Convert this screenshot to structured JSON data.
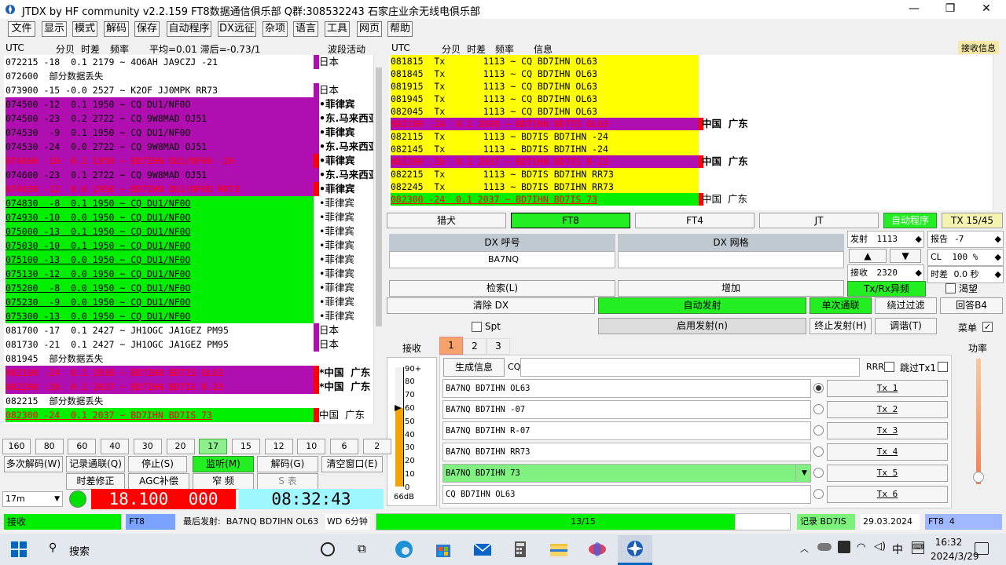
{
  "window": {
    "title": "JTDX by HF community  v2.2.159 FT8数据通信俱乐部 Q群:308532243 石家庄业余无线电俱乐部",
    "controls": [
      "—",
      "❐",
      "✕"
    ]
  },
  "menu": [
    "文件",
    "显示",
    "模式",
    "解码",
    "保存",
    "自动程序",
    "DX远征",
    "杂项",
    "语言",
    "工具",
    "网页",
    "帮助"
  ],
  "left_header": {
    "utc": "UTC",
    "db": "分贝",
    "dt": "时差",
    "freq": "频率",
    "stats": "平均=0.01 滞后=-0.73/1",
    "band": "波段活动"
  },
  "right_header": {
    "utc": "UTC",
    "db": "分贝",
    "dt": "时差",
    "freq": "频率",
    "msg": "信息",
    "rxinfo": "接收信息"
  },
  "band_activity": [
    {
      "text": "072215 -18  0.1 2179 ~ 4O6AH JA9CZJ -21",
      "country": "日本",
      "bg": "#ffffff",
      "fg": "#000000",
      "flag": "#b10eb1",
      "cw": "normal"
    },
    {
      "text": "072600  部分数据丢失",
      "country": "",
      "bg": "#ffffff",
      "fg": "#000000",
      "flag": "",
      "cw": "normal"
    },
    {
      "text": "073900 -15 -0.0 2527 ~ K2OF JJ0MPK RR73",
      "country": "日本",
      "bg": "#ffffff",
      "fg": "#000000",
      "flag": "#b10eb1",
      "cw": "normal"
    },
    {
      "text": "074500 -12  0.1 1950 ~ CQ DU1/NF0O",
      "country": "•菲律宾",
      "bg": "#b10eb1",
      "fg": "#000000",
      "flag": "#b10eb1",
      "cw": "bold"
    },
    {
      "text": "074500 -23  0.2 2722 ~ CQ 9W8MAD OJ51",
      "country": "•东.马来西亚",
      "bg": "#b10eb1",
      "fg": "#000000",
      "flag": "#b10eb1",
      "cw": "bold"
    },
    {
      "text": "074530  -9  0.1 1950 ~ CQ DU1/NF0O",
      "country": "•菲律宾",
      "bg": "#b10eb1",
      "fg": "#000000",
      "flag": "#b10eb1",
      "cw": "bold"
    },
    {
      "text": "074530 -24  0.0 2722 ~ CQ 9W8MAD OJ51",
      "country": "•东.马来西亚",
      "bg": "#b10eb1",
      "fg": "#000000",
      "flag": "#b10eb1",
      "cw": "bold"
    },
    {
      "text": "074600 -10  0.1 1950 ~ BD7IHN DU1/NF0O -20",
      "country": "•菲律宾",
      "bg": "#b10eb1",
      "fg": "#ff0000",
      "flag": "#ff0000",
      "cw": "bold"
    },
    {
      "text": "074600 -23  0.1 2722 ~ CQ 9W8MAD OJ51",
      "country": "•东.马来西亚",
      "bg": "#b10eb1",
      "fg": "#000000",
      "flag": "#b10eb1",
      "cw": "bold"
    },
    {
      "text": "074630 -12  0.0 1950 ~ BD7IHN DU1/NF0O RR73",
      "country": "•菲律宾",
      "bg": "#b10eb1",
      "fg": "#ff0000",
      "flag": "#ff0000",
      "cw": "bold"
    },
    {
      "text": "074830  -8  0.1 1950 ~ CQ DU1/NF0O",
      "country": "•菲律宾",
      "bg": "#00ee00",
      "fg": "#000000",
      "flag": "",
      "cw": "normal",
      "u": true
    },
    {
      "text": "074930 -10  0.0 1950 ~ CQ DU1/NF0O",
      "country": "•菲律宾",
      "bg": "#00ee00",
      "fg": "#000000",
      "flag": "",
      "cw": "normal",
      "u": true
    },
    {
      "text": "075000 -13  0.1 1950 ~ CQ DU1/NF0O",
      "country": "•菲律宾",
      "bg": "#00ee00",
      "fg": "#000000",
      "flag": "",
      "cw": "normal",
      "u": true
    },
    {
      "text": "075030 -10  0.1 1950 ~ CQ DU1/NF0O",
      "country": "•菲律宾",
      "bg": "#00ee00",
      "fg": "#000000",
      "flag": "",
      "cw": "normal",
      "u": true
    },
    {
      "text": "075100 -13  0.0 1950 ~ CQ DU1/NF0O",
      "country": "•菲律宾",
      "bg": "#00ee00",
      "fg": "#000000",
      "flag": "",
      "cw": "normal",
      "u": true
    },
    {
      "text": "075130 -12  0.0 1950 ~ CQ DU1/NF0O",
      "country": "•菲律宾",
      "bg": "#00ee00",
      "fg": "#000000",
      "flag": "",
      "cw": "normal",
      "u": true
    },
    {
      "text": "075200  -8  0.0 1950 ~ CQ DU1/NF0O",
      "country": "•菲律宾",
      "bg": "#00ee00",
      "fg": "#000000",
      "flag": "",
      "cw": "normal",
      "u": true
    },
    {
      "text": "075230  -9  0.0 1950 ~ CQ DU1/NF0O",
      "country": "•菲律宾",
      "bg": "#00ee00",
      "fg": "#000000",
      "flag": "",
      "cw": "normal",
      "u": true
    },
    {
      "text": "075300 -13  0.0 1950 ~ CQ DU1/NF0O",
      "country": "•菲律宾",
      "bg": "#00ee00",
      "fg": "#000000",
      "flag": "",
      "cw": "normal",
      "u": true
    },
    {
      "text": "081700 -17  0.1 2427 ~ JH1OGC JA1GEZ PM95",
      "country": "日本",
      "bg": "#ffffff",
      "fg": "#000000",
      "flag": "#b10eb1",
      "cw": "normal"
    },
    {
      "text": "081730 -21  0.1 2427 ~ JH1OGC JA1GEZ PM95",
      "country": "日本",
      "bg": "#ffffff",
      "fg": "#000000",
      "flag": "#b10eb1",
      "cw": "normal"
    },
    {
      "text": "081945  部分数据丢失",
      "country": "",
      "bg": "#ffffff",
      "fg": "#000000",
      "flag": "",
      "cw": "normal"
    },
    {
      "text": "082100 -24  0.1 2038 ~ BD7IHN BD7IS OL63",
      "country": "*中国  广东",
      "bg": "#b10eb1",
      "fg": "#ff0000",
      "flag": "#ff0000",
      "cw": "bold"
    },
    {
      "text": "082200 -26  0.1 2037 ~ BD7IHN BD7IS R-23",
      "country": "*中国  广东",
      "bg": "#b10eb1",
      "fg": "#ff0000",
      "flag": "#ff0000",
      "cw": "bold"
    },
    {
      "text": "082215  部分数据丢失",
      "country": "",
      "bg": "#ffffff",
      "fg": "#000000",
      "flag": "",
      "cw": "normal"
    },
    {
      "text": "082300 -24  0.1 2037 ~ BD7IHN BD7IS 73",
      "country": "中国  广东",
      "bg": "#00ee00",
      "fg": "#ff0000",
      "flag": "#ff0000",
      "cw": "normal",
      "u": true
    },
    {
      "text": "082345  部分数据丢失",
      "country": "",
      "bg": "#ffffff",
      "fg": "#000000",
      "flag": "",
      "cw": "normal"
    }
  ],
  "rx_messages": [
    {
      "text": "081815  Tx       1113 ~ CQ BD7IHN OL63",
      "country": "",
      "bg": "#ffff00",
      "fg": "#000000",
      "flag": "",
      "u": false
    },
    {
      "text": "081845  Tx       1113 ~ CQ BD7IHN OL63",
      "country": "",
      "bg": "#ffff00",
      "fg": "#000000",
      "flag": "",
      "u": false
    },
    {
      "text": "081915  Tx       1113 ~ CQ BD7IHN OL63",
      "country": "",
      "bg": "#ffff00",
      "fg": "#000000",
      "flag": "",
      "u": false
    },
    {
      "text": "081945  Tx       1113 ~ CQ BD7IHN OL63",
      "country": "",
      "bg": "#ffff00",
      "fg": "#000000",
      "flag": "",
      "u": false
    },
    {
      "text": "082045  Tx       1113 ~ CQ BD7IHN OL63",
      "country": "",
      "bg": "#ffff00",
      "fg": "#000000",
      "flag": "",
      "u": false
    },
    {
      "text": "082100 -24  0.1 2038 ~ BD7IHN BD7IS OL63",
      "country": "中国  广东",
      "bg": "#b10eb1",
      "fg": "#ff0000",
      "flag": "#ff0000",
      "u": false
    },
    {
      "text": "082115  Tx       1113 ~ BD7IS BD7IHN -24",
      "country": "",
      "bg": "#ffff00",
      "fg": "#000000",
      "flag": "",
      "u": false
    },
    {
      "text": "082145  Tx       1113 ~ BD7IS BD7IHN -24",
      "country": "",
      "bg": "#ffff00",
      "fg": "#000000",
      "flag": "",
      "u": false
    },
    {
      "text": "082200 -26  0.1 2037 ~ BD7IHN BD7IS R-23",
      "country": "中国  广东",
      "bg": "#b10eb1",
      "fg": "#ff0000",
      "flag": "#ff0000",
      "u": false
    },
    {
      "text": "082215  Tx       1113 ~ BD7IS BD7IHN RR73",
      "country": "",
      "bg": "#ffff00",
      "fg": "#000000",
      "flag": "",
      "u": false
    },
    {
      "text": "082245  Tx       1113 ~ BD7IS BD7IHN RR73",
      "country": "",
      "bg": "#ffff00",
      "fg": "#000000",
      "flag": "",
      "u": false
    },
    {
      "text": "082300 -24  0.1 2037 ~ BD7IHN BD7IS 73",
      "country": "中国  广东",
      "bg": "#00ee00",
      "fg": "#ff0000",
      "flag": "#ff0000",
      "u": true
    }
  ],
  "bands": [
    "160",
    "80",
    "60",
    "40",
    "30",
    "20",
    "17",
    "15",
    "12",
    "10",
    "6",
    "2"
  ],
  "active_band": "17",
  "left_buttons_row1": [
    "多次解码(W)",
    "记录通联(Q)",
    "停止(S)",
    "监听(M)",
    "解码(G)",
    "清空窗口(E)"
  ],
  "left_buttons_row2": [
    "时差修正",
    "AGC补偿",
    "窄 频",
    "S 表"
  ],
  "band_select": "17m",
  "frequency": "18.100  000",
  "clock": "08:32:43",
  "mode_buttons": [
    "猎犬",
    "FT8",
    "FT4",
    "JT",
    "自动程序",
    "TX 15/45"
  ],
  "dx": {
    "call_label": "DX 呼号",
    "grid_label": "DX 网格",
    "call": "BA7NQ",
    "grid": ""
  },
  "tx_freq": {
    "label": "发射",
    "value": "1113"
  },
  "rx_freq": {
    "label": "接收",
    "value": "2320"
  },
  "report": {
    "label": "报告",
    "value": "-7"
  },
  "cl": {
    "label": "CL",
    "value": "100 %"
  },
  "time_offset": {
    "label": "时差",
    "value": "0.0 秒"
  },
  "txrx_split": "Tx/Rx异频",
  "hope": "渴望",
  "buttons": {
    "search": "检索(L)",
    "add": "增加",
    "clear_dx": "清除 DX",
    "auto_tx": "自动发射",
    "single_qso": "单次通联",
    "skip_filter": "绕过过滤",
    "reply_b4": "回答B4",
    "spt": "Spt",
    "enable_tx": "启用发射(n)",
    "stop_tx": "终止发射(H)",
    "tune": "调谐(T)",
    "menu": "菜单"
  },
  "rx_label": "接收",
  "power_label": "功率",
  "tabs": [
    "1",
    "2",
    "3"
  ],
  "generate": {
    "label": "生成信息",
    "prefix": "CQ",
    "value": "",
    "rrr": "RRR",
    "skip_tx1": "跳过Tx1"
  },
  "tx_messages": [
    {
      "text": "BA7NQ BD7IHN OL63",
      "btn": "Tx 1",
      "selected": true,
      "highlight": false
    },
    {
      "text": "BA7NQ BD7IHN -07",
      "btn": "Tx 2",
      "selected": false,
      "highlight": false
    },
    {
      "text": "BA7NQ BD7IHN R-07",
      "btn": "Tx 3",
      "selected": false,
      "highlight": false
    },
    {
      "text": "BA7NQ BD7IHN RR73",
      "btn": "Tx 4",
      "selected": false,
      "highlight": false
    },
    {
      "text": "BA7NQ BD7IHN 73",
      "btn": "Tx 5",
      "selected": false,
      "highlight": true
    },
    {
      "text": "CQ BD7IHN OL63",
      "btn": "Tx 6",
      "selected": false,
      "highlight": false
    }
  ],
  "meter": {
    "ticks": [
      "90+",
      "80",
      "70",
      "60",
      "50",
      "40",
      "30",
      "20",
      "10",
      "0"
    ],
    "unit": "66dB",
    "level": 0.66
  },
  "power_level": 0.05,
  "status": {
    "rx": "接收",
    "mode": "FT8",
    "last_tx": "最后发射:  BA7NQ BD7IHN OL63",
    "wd": "WD 6分钟",
    "progress": "13/15",
    "progress_value": 0.8667,
    "log": "记录 BD7IS",
    "date": "29.03.2024",
    "ft8": "FT8  4"
  },
  "taskbar": {
    "search": "搜索",
    "time": "16:32",
    "date": "2024/3/29",
    "ime": "中"
  }
}
